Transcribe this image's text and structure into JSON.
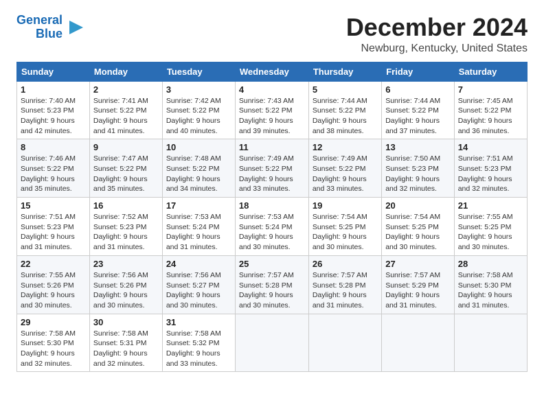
{
  "logo": {
    "line1": "General",
    "line2": "Blue"
  },
  "header": {
    "month": "December 2024",
    "location": "Newburg, Kentucky, United States"
  },
  "weekdays": [
    "Sunday",
    "Monday",
    "Tuesday",
    "Wednesday",
    "Thursday",
    "Friday",
    "Saturday"
  ],
  "weeks": [
    [
      {
        "day": "1",
        "sunrise": "7:40 AM",
        "sunset": "5:23 PM",
        "daylight": "9 hours and 42 minutes."
      },
      {
        "day": "2",
        "sunrise": "7:41 AM",
        "sunset": "5:22 PM",
        "daylight": "9 hours and 41 minutes."
      },
      {
        "day": "3",
        "sunrise": "7:42 AM",
        "sunset": "5:22 PM",
        "daylight": "9 hours and 40 minutes."
      },
      {
        "day": "4",
        "sunrise": "7:43 AM",
        "sunset": "5:22 PM",
        "daylight": "9 hours and 39 minutes."
      },
      {
        "day": "5",
        "sunrise": "7:44 AM",
        "sunset": "5:22 PM",
        "daylight": "9 hours and 38 minutes."
      },
      {
        "day": "6",
        "sunrise": "7:44 AM",
        "sunset": "5:22 PM",
        "daylight": "9 hours and 37 minutes."
      },
      {
        "day": "7",
        "sunrise": "7:45 AM",
        "sunset": "5:22 PM",
        "daylight": "9 hours and 36 minutes."
      }
    ],
    [
      {
        "day": "8",
        "sunrise": "7:46 AM",
        "sunset": "5:22 PM",
        "daylight": "9 hours and 35 minutes."
      },
      {
        "day": "9",
        "sunrise": "7:47 AM",
        "sunset": "5:22 PM",
        "daylight": "9 hours and 35 minutes."
      },
      {
        "day": "10",
        "sunrise": "7:48 AM",
        "sunset": "5:22 PM",
        "daylight": "9 hours and 34 minutes."
      },
      {
        "day": "11",
        "sunrise": "7:49 AM",
        "sunset": "5:22 PM",
        "daylight": "9 hours and 33 minutes."
      },
      {
        "day": "12",
        "sunrise": "7:49 AM",
        "sunset": "5:22 PM",
        "daylight": "9 hours and 33 minutes."
      },
      {
        "day": "13",
        "sunrise": "7:50 AM",
        "sunset": "5:23 PM",
        "daylight": "9 hours and 32 minutes."
      },
      {
        "day": "14",
        "sunrise": "7:51 AM",
        "sunset": "5:23 PM",
        "daylight": "9 hours and 32 minutes."
      }
    ],
    [
      {
        "day": "15",
        "sunrise": "7:51 AM",
        "sunset": "5:23 PM",
        "daylight": "9 hours and 31 minutes."
      },
      {
        "day": "16",
        "sunrise": "7:52 AM",
        "sunset": "5:23 PM",
        "daylight": "9 hours and 31 minutes."
      },
      {
        "day": "17",
        "sunrise": "7:53 AM",
        "sunset": "5:24 PM",
        "daylight": "9 hours and 31 minutes."
      },
      {
        "day": "18",
        "sunrise": "7:53 AM",
        "sunset": "5:24 PM",
        "daylight": "9 hours and 30 minutes."
      },
      {
        "day": "19",
        "sunrise": "7:54 AM",
        "sunset": "5:25 PM",
        "daylight": "9 hours and 30 minutes."
      },
      {
        "day": "20",
        "sunrise": "7:54 AM",
        "sunset": "5:25 PM",
        "daylight": "9 hours and 30 minutes."
      },
      {
        "day": "21",
        "sunrise": "7:55 AM",
        "sunset": "5:25 PM",
        "daylight": "9 hours and 30 minutes."
      }
    ],
    [
      {
        "day": "22",
        "sunrise": "7:55 AM",
        "sunset": "5:26 PM",
        "daylight": "9 hours and 30 minutes."
      },
      {
        "day": "23",
        "sunrise": "7:56 AM",
        "sunset": "5:26 PM",
        "daylight": "9 hours and 30 minutes."
      },
      {
        "day": "24",
        "sunrise": "7:56 AM",
        "sunset": "5:27 PM",
        "daylight": "9 hours and 30 minutes."
      },
      {
        "day": "25",
        "sunrise": "7:57 AM",
        "sunset": "5:28 PM",
        "daylight": "9 hours and 30 minutes."
      },
      {
        "day": "26",
        "sunrise": "7:57 AM",
        "sunset": "5:28 PM",
        "daylight": "9 hours and 31 minutes."
      },
      {
        "day": "27",
        "sunrise": "7:57 AM",
        "sunset": "5:29 PM",
        "daylight": "9 hours and 31 minutes."
      },
      {
        "day": "28",
        "sunrise": "7:58 AM",
        "sunset": "5:30 PM",
        "daylight": "9 hours and 31 minutes."
      }
    ],
    [
      {
        "day": "29",
        "sunrise": "7:58 AM",
        "sunset": "5:30 PM",
        "daylight": "9 hours and 32 minutes."
      },
      {
        "day": "30",
        "sunrise": "7:58 AM",
        "sunset": "5:31 PM",
        "daylight": "9 hours and 32 minutes."
      },
      {
        "day": "31",
        "sunrise": "7:58 AM",
        "sunset": "5:32 PM",
        "daylight": "9 hours and 33 minutes."
      },
      null,
      null,
      null,
      null
    ]
  ]
}
